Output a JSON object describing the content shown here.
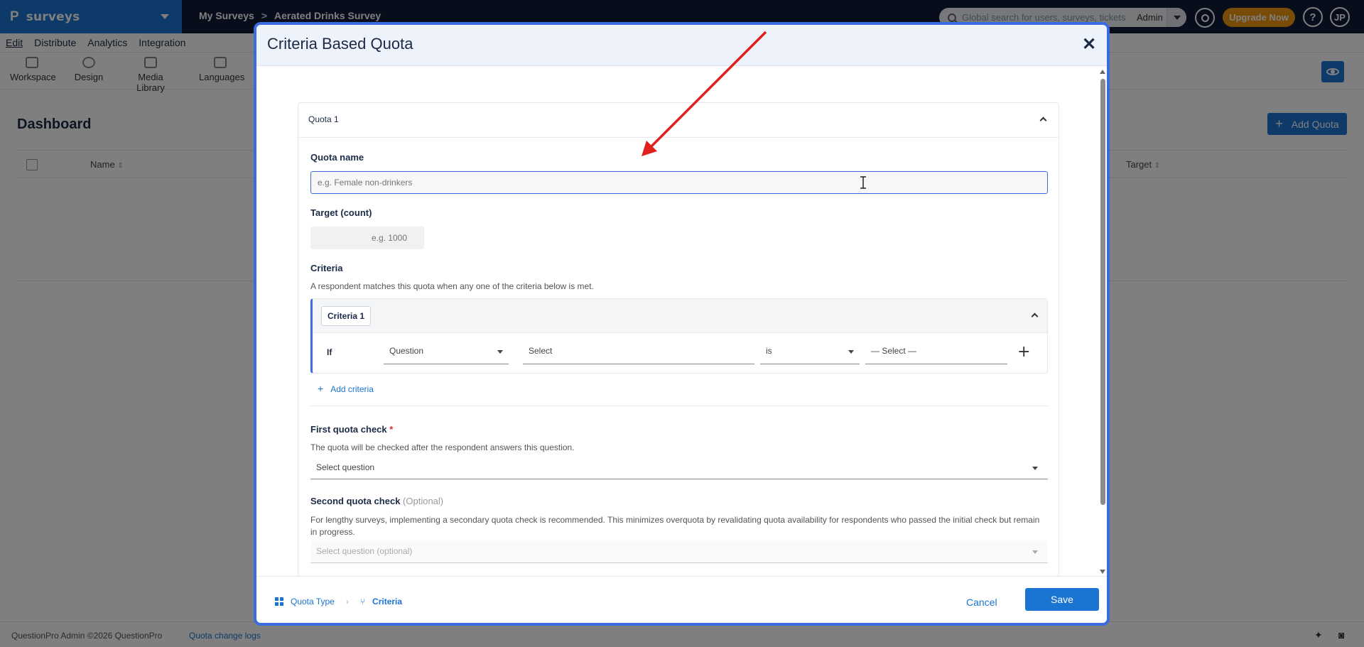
{
  "topbar": {
    "brand": "surveys",
    "breadcrumbs": [
      "My Surveys",
      "Aerated Drinks Survey"
    ],
    "search_placeholder": "Global search for users, surveys, tickets",
    "role": "Admin",
    "upgrade_label": "Upgrade Now",
    "help_label": "?",
    "avatar_initials": "JP"
  },
  "menubar": [
    "Edit",
    "Distribute",
    "Analytics",
    "Integration"
  ],
  "toolbar": [
    "Workspace",
    "Design",
    "Media Library",
    "Languages"
  ],
  "dashboard": {
    "title": "Dashboard",
    "add_quota_label": "Add Quota",
    "columns": [
      "Name",
      "Target"
    ]
  },
  "footer": {
    "copyright": "QuestionPro Admin ©2026 QuestionPro",
    "log_link": "Quota change logs"
  },
  "modal": {
    "title": "Criteria Based Quota",
    "quota_card_title": "Quota 1",
    "quota_name_label": "Quota name",
    "quota_name_placeholder": "e.g. Female non-drinkers",
    "target_label": "Target (count)",
    "target_placeholder": "e.g. 1000",
    "criteria_label": "Criteria",
    "criteria_help": "A respondent matches this quota when any one of the criteria below is met.",
    "criteria_badge": "Criteria 1",
    "if_label": "If",
    "criteria_type": "Question",
    "criteria_select": "Select",
    "operator": "is",
    "value_select": "— Select —",
    "add_criteria_label": "Add criteria",
    "first_check_label": "First quota check",
    "first_check_help": "The quota will be checked after the respondent answers this question.",
    "first_check_placeholder": "Select question",
    "second_check_label": "Second quota check",
    "second_check_optional": "(Optional)",
    "second_check_help": "For lengthy surveys, implementing a secondary quota check is recommended. This minimizes overquota by revalidating quota availability for respondents who passed the initial check but remain in progress.",
    "second_check_placeholder": "Select question (optional)",
    "steps": [
      "Quota Type",
      "Criteria"
    ],
    "cancel_label": "Cancel",
    "save_label": "Save"
  }
}
